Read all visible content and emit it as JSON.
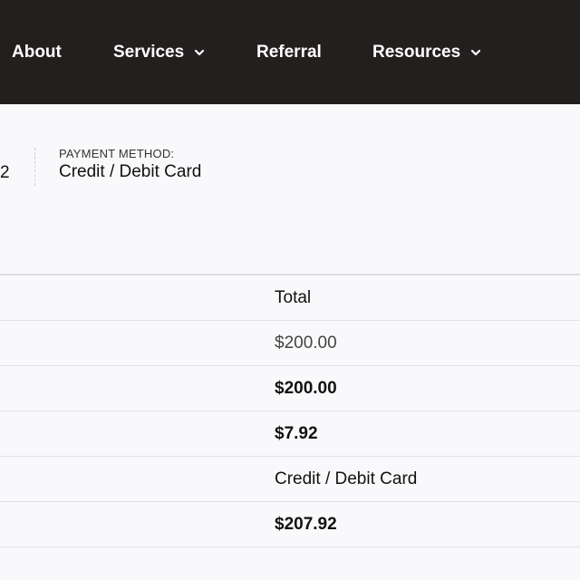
{
  "nav": {
    "items": [
      {
        "label": "About",
        "has_dropdown": false
      },
      {
        "label": "Services",
        "has_dropdown": true
      },
      {
        "label": "Referral",
        "has_dropdown": false
      },
      {
        "label": "Resources",
        "has_dropdown": true
      }
    ],
    "background": "#231f1e",
    "text_color": "#ffffff"
  },
  "order_details": {
    "order_fragment": "2",
    "payment_method_label": "PAYMENT METHOD:",
    "payment_method_value": "Credit / Debit Card"
  },
  "table": {
    "header": "Total",
    "rows": [
      {
        "value": "$200.00",
        "style": "light"
      },
      {
        "value": "$200.00",
        "style": "bold"
      },
      {
        "value": "$7.92",
        "style": "bold"
      },
      {
        "value": "Credit / Debit Card",
        "style": "normal"
      },
      {
        "value": "$207.92",
        "style": "bold"
      }
    ]
  },
  "colors": {
    "page_background": "#f9f9fb",
    "divider": "#e2e2e6"
  }
}
